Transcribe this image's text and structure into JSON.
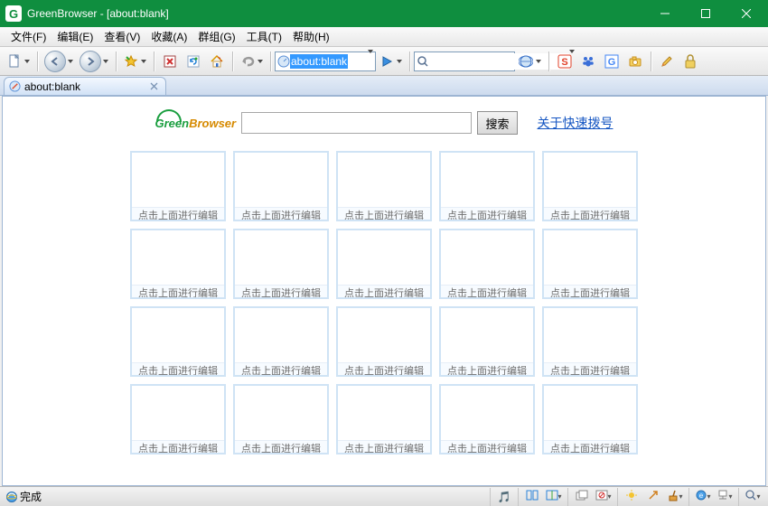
{
  "window": {
    "title": "GreenBrowser - [about:blank]"
  },
  "menu": {
    "file": "文件(F)",
    "edit": "编辑(E)",
    "view": "查看(V)",
    "favorites": "收藏(A)",
    "groups": "群组(G)",
    "tools": "工具(T)",
    "help": "帮助(H)"
  },
  "toolbar": {
    "address_value": "about:blank",
    "search_value": ""
  },
  "tab": {
    "label": "about:blank"
  },
  "page": {
    "logo_left": "Green",
    "logo_right": "Browser",
    "search_placeholder": "",
    "search_button": "搜索",
    "about_link": "关于快速拨号",
    "cell_caption": "点击上面进行编辑"
  },
  "status": {
    "text": "完成"
  }
}
